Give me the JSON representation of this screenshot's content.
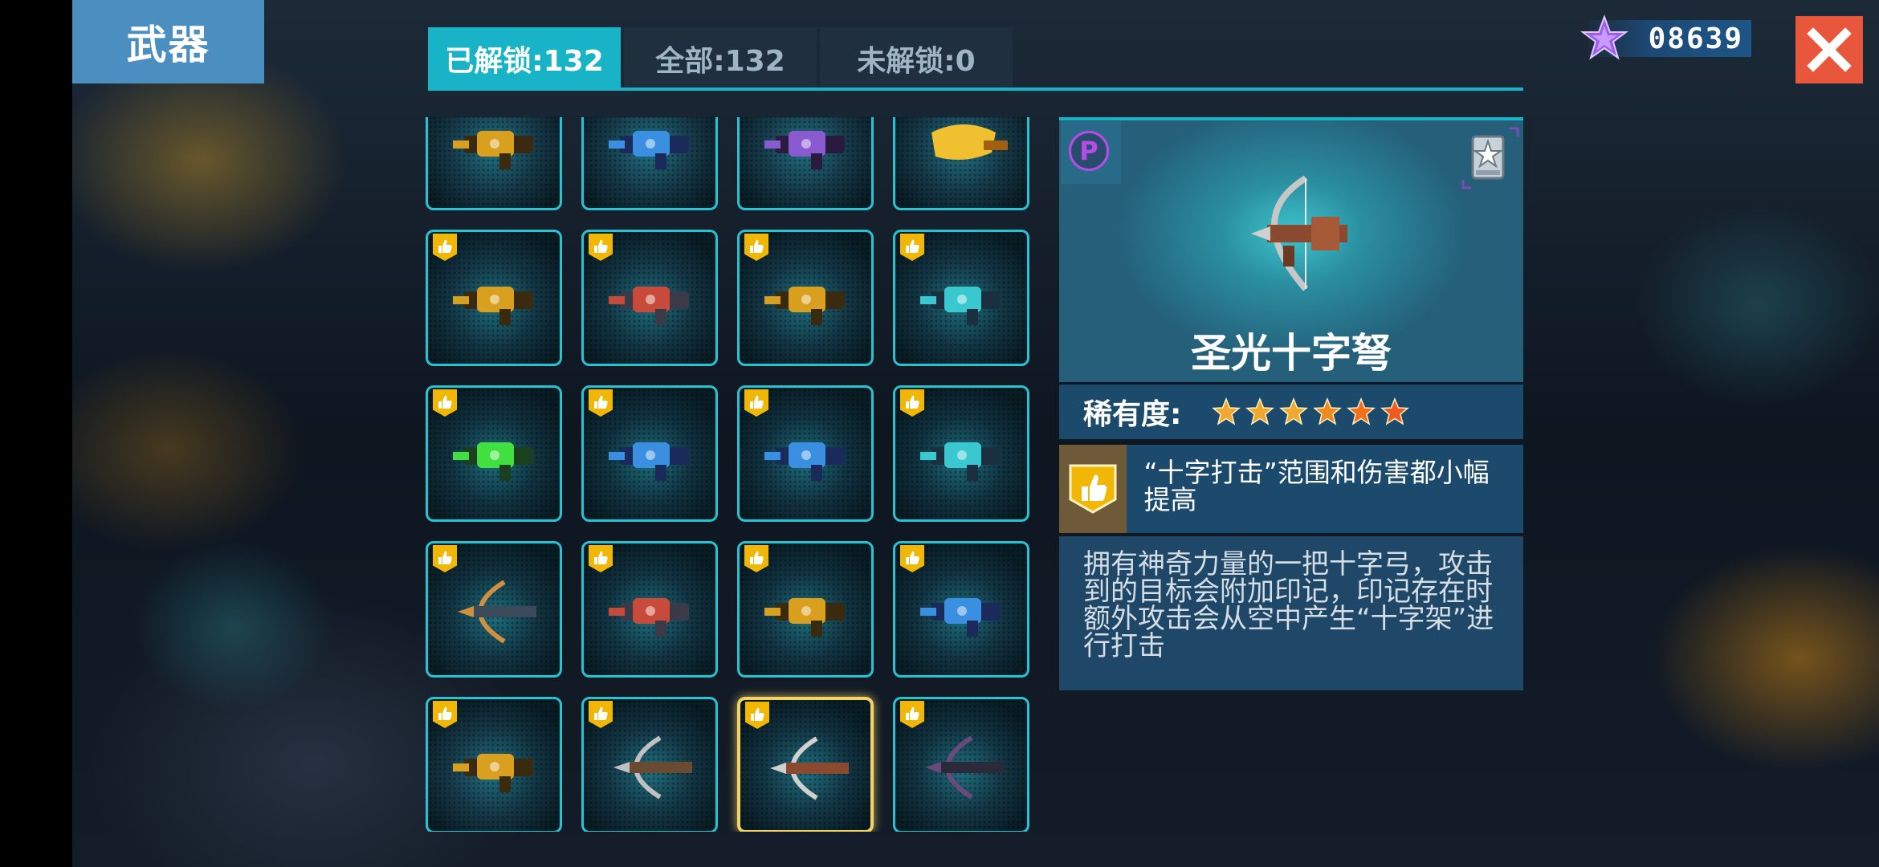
{
  "header": {
    "title": "武器",
    "currency": {
      "icon": "purple-star-gem-icon",
      "value": "08639"
    },
    "close_icon": "close-icon"
  },
  "tabs": [
    {
      "label": "已解锁:132",
      "active": true
    },
    {
      "label": "全部:132",
      "active": false
    },
    {
      "label": "未解锁:0",
      "active": false
    }
  ],
  "weapon_grid": {
    "columns": 4,
    "cells": [
      {
        "weapon": "gold-grenade-launcher",
        "unlocked_badge": false
      },
      {
        "weapon": "blue-plasma-blaster",
        "unlocked_badge": false
      },
      {
        "weapon": "purple-energy-cannon",
        "unlocked_badge": false
      },
      {
        "weapon": "flaming-cleaver",
        "unlocked_badge": false
      },
      {
        "weapon": "gold-minigun",
        "unlocked_badge": true
      },
      {
        "weapon": "red-drill-launcher",
        "unlocked_badge": true
      },
      {
        "weapon": "gold-sonic-cannon",
        "unlocked_badge": true
      },
      {
        "weapon": "teal-drill-gun",
        "unlocked_badge": true
      },
      {
        "weapon": "green-bio-blaster",
        "unlocked_badge": true
      },
      {
        "weapon": "blue-bird-gun",
        "unlocked_badge": true
      },
      {
        "weapon": "blue-orb-cannon",
        "unlocked_badge": true
      },
      {
        "weapon": "teal-tesla-cannon",
        "unlocked_badge": true
      },
      {
        "weapon": "energy-crossbow-cannon",
        "unlocked_badge": true
      },
      {
        "weapon": "red-rocket-launcher",
        "unlocked_badge": true
      },
      {
        "weapon": "gold-assault-rifle",
        "unlocked_badge": true
      },
      {
        "weapon": "blue-heavy-rifle",
        "unlocked_badge": true
      },
      {
        "weapon": "gold-spiked-mace-gun",
        "unlocked_badge": true
      },
      {
        "weapon": "silver-crossbow",
        "unlocked_badge": true
      },
      {
        "weapon": "holy-cross-crossbow",
        "unlocked_badge": true,
        "selected": true
      },
      {
        "weapon": "dark-crossbow",
        "unlocked_badge": true
      }
    ]
  },
  "detail": {
    "tier_badge": "P",
    "rank_icon": "silver-star-rank-icon",
    "name": "圣光十字弩",
    "rarity_label": "稀有度:",
    "rarity_stars": 6,
    "rarity_colors": [
      "#f0a830",
      "#f0a830",
      "#f0a830",
      "#f08a20",
      "#f07020",
      "#f05a20"
    ],
    "perk_icon": "thumbs-up-shield-icon",
    "perk_text": "“十字打击”范围和伤害都小幅提高",
    "description": "拥有神奇力量的一把十字弓，攻击到的目标会附加印记，印记存在时额外攻击会从空中产生“十字架”进行打击"
  }
}
